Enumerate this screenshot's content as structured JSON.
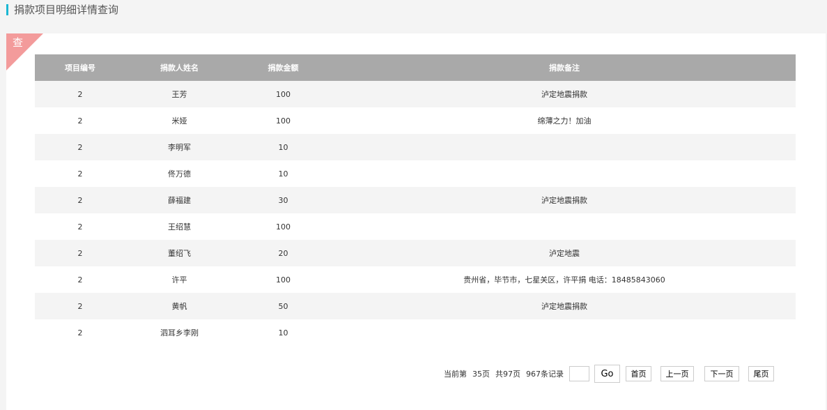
{
  "header": {
    "title": "捐款项目明细详情查询"
  },
  "panel": {
    "corner_label": "查"
  },
  "table": {
    "columns": [
      "项目编号",
      "捐款人姓名",
      "捐款金额",
      "捐款备注"
    ],
    "rows": [
      [
        "2",
        "王芳",
        "100",
        "泸定地震捐款"
      ],
      [
        "2",
        "米娅",
        "100",
        "绵薄之力！加油"
      ],
      [
        "2",
        "李明军",
        "10",
        ""
      ],
      [
        "2",
        "佟万德",
        "10",
        ""
      ],
      [
        "2",
        "薛福建",
        "30",
        "泸定地震捐款"
      ],
      [
        "2",
        "王绍慧",
        "100",
        ""
      ],
      [
        "2",
        "董绍飞",
        "20",
        "泸定地震"
      ],
      [
        "2",
        "许平",
        "100",
        "贵州省，毕节市，七星关区，许平捐 电话：18485843060"
      ],
      [
        "2",
        "黄帆",
        "50",
        "泸定地震捐款"
      ],
      [
        "2",
        "泗耳乡李刚",
        "10",
        ""
      ]
    ]
  },
  "pager": {
    "current_prefix": "当前第",
    "current_page": "35页",
    "total_pages": "共97页",
    "total_records": "967条记录",
    "page_input_value": "",
    "go_label": "Go",
    "first_label": "首页",
    "prev_label": "上一页",
    "next_label": "下一页",
    "last_label": "尾页"
  }
}
